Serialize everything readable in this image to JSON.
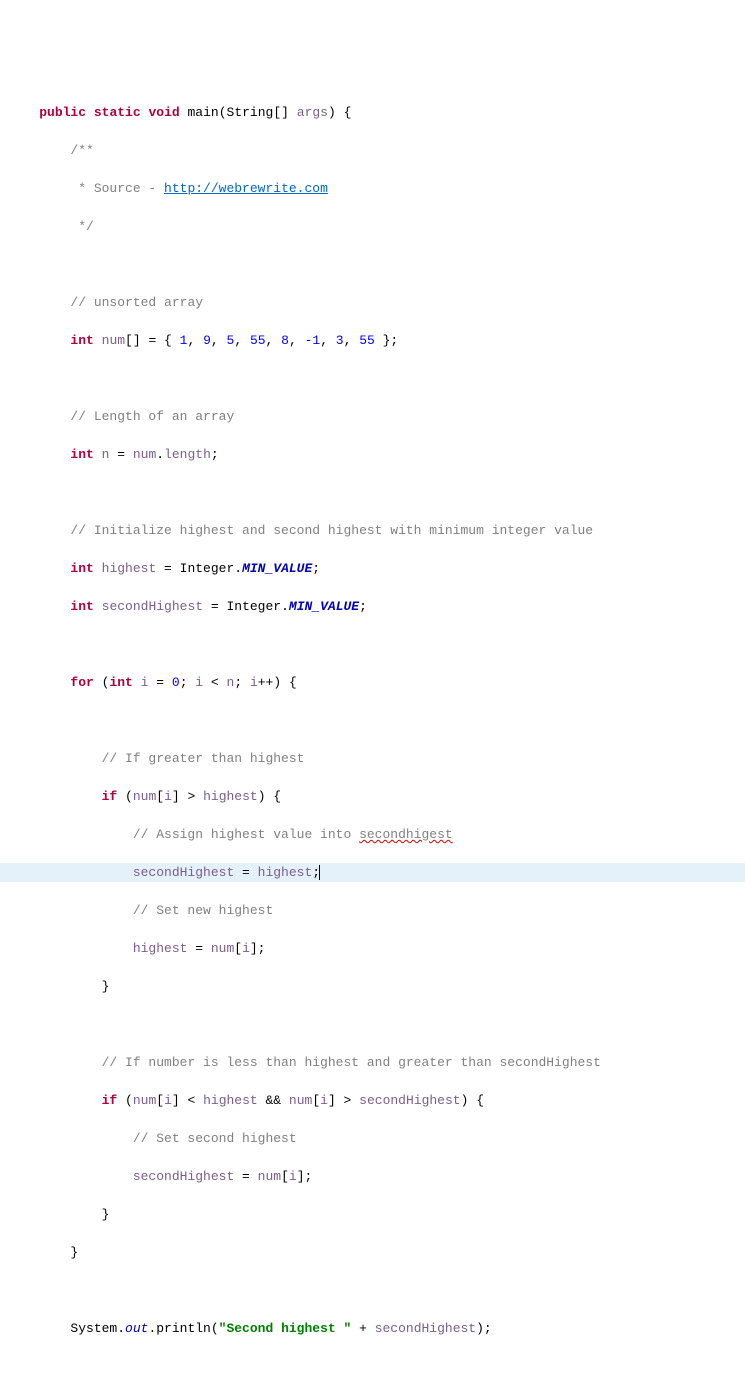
{
  "code": {
    "line1": {
      "kw_public": "public",
      "kw_static": "static",
      "kw_void": "void",
      "method": "main",
      "type_string": "String",
      "brackets": "[]",
      "param": "args",
      "brace": ") {"
    },
    "line2": {
      "open_block": "/**"
    },
    "line3": {
      "star": " * ",
      "text": "Source - ",
      "url": "http://webrewrite.com"
    },
    "line4": {
      "close_block": " */"
    },
    "line5": {
      "empty": ""
    },
    "line6": {
      "comment": "// unsorted array"
    },
    "line7": {
      "kw_int": "int",
      "var": "num",
      "brackets": "[]",
      "eq": " = { ",
      "v1": "1",
      "c1": ", ",
      "v2": "9",
      "c2": ", ",
      "v3": "5",
      "c3": ", ",
      "v4": "55",
      "c4": ", ",
      "v5": "8",
      "c5": ", ",
      "v6": "-1",
      "c6": ", ",
      "v7": "3",
      "c7": ", ",
      "v8": "55",
      "end": " };"
    },
    "line8": {
      "empty": ""
    },
    "line9": {
      "comment": "// Length of an array"
    },
    "line10": {
      "kw_int": "int",
      "var_n": "n",
      "eq": " = ",
      "var_num": "num",
      "dot": ".",
      "field": "length",
      "semi": ";"
    },
    "line11": {
      "empty": ""
    },
    "line12": {
      "comment": "// Initialize highest and second highest with minimum integer value"
    },
    "line13": {
      "kw_int": "int",
      "var": "highest",
      "eq": " = Integer.",
      "const": "MIN_VALUE",
      "semi": ";"
    },
    "line14": {
      "kw_int": "int",
      "var": "secondHighest",
      "eq": " = Integer.",
      "const": "MIN_VALUE",
      "semi": ";"
    },
    "line15": {
      "empty": ""
    },
    "line16": {
      "kw_for": "for",
      "open": " (",
      "kw_int": "int",
      "var_i": "i",
      "eq": " = ",
      "zero": "0",
      "semi1": "; ",
      "var_i2": "i",
      "lt": " < ",
      "var_n": "n",
      "semi2": "; ",
      "var_i3": "i",
      "inc": "++) {"
    },
    "line17": {
      "empty": ""
    },
    "line18": {
      "comment": "// If greater than highest"
    },
    "line19": {
      "kw_if": "if",
      "open": " (",
      "var_num": "num",
      "lb": "[",
      "var_i": "i",
      "rb": "] > ",
      "var_h": "highest",
      "end": ") {"
    },
    "line20": {
      "comment_prefix": "// Assign highest value into ",
      "squiggle": "secondhigest"
    },
    "line21": {
      "var_sh": "secondHighest",
      "eq": " = ",
      "var_h": "highest",
      "semi": ";"
    },
    "line22": {
      "comment": "// Set new highest"
    },
    "line23": {
      "var_h": "highest",
      "eq": " = ",
      "var_num": "num",
      "lb": "[",
      "var_i": "i",
      "rb": "];"
    },
    "line24": {
      "brace": "}"
    },
    "line25": {
      "empty": ""
    },
    "line26": {
      "comment": "// If number is less than highest and greater than secondHighest"
    },
    "line27": {
      "kw_if": "if",
      "open": " (",
      "var_num1": "num",
      "lb1": "[",
      "var_i1": "i",
      "rb1": "] < ",
      "var_h": "highest",
      "and": " && ",
      "var_num2": "num",
      "lb2": "[",
      "var_i2": "i",
      "rb2": "] > ",
      "var_sh": "secondHighest",
      "end": ") {"
    },
    "line28": {
      "comment": "// Set second highest"
    },
    "line29": {
      "var_sh": "secondHighest",
      "eq": " = ",
      "var_num": "num",
      "lb": "[",
      "var_i": "i",
      "rb": "];"
    },
    "line30": {
      "brace": "}"
    },
    "line31": {
      "brace": "}"
    },
    "line32": {
      "empty": ""
    },
    "line33": {
      "sys": "System.",
      "out": "out",
      "dot": ".println(",
      "str": "\"Second highest \"",
      "plus": " + ",
      "var": "secondHighest",
      "end": ");"
    }
  }
}
